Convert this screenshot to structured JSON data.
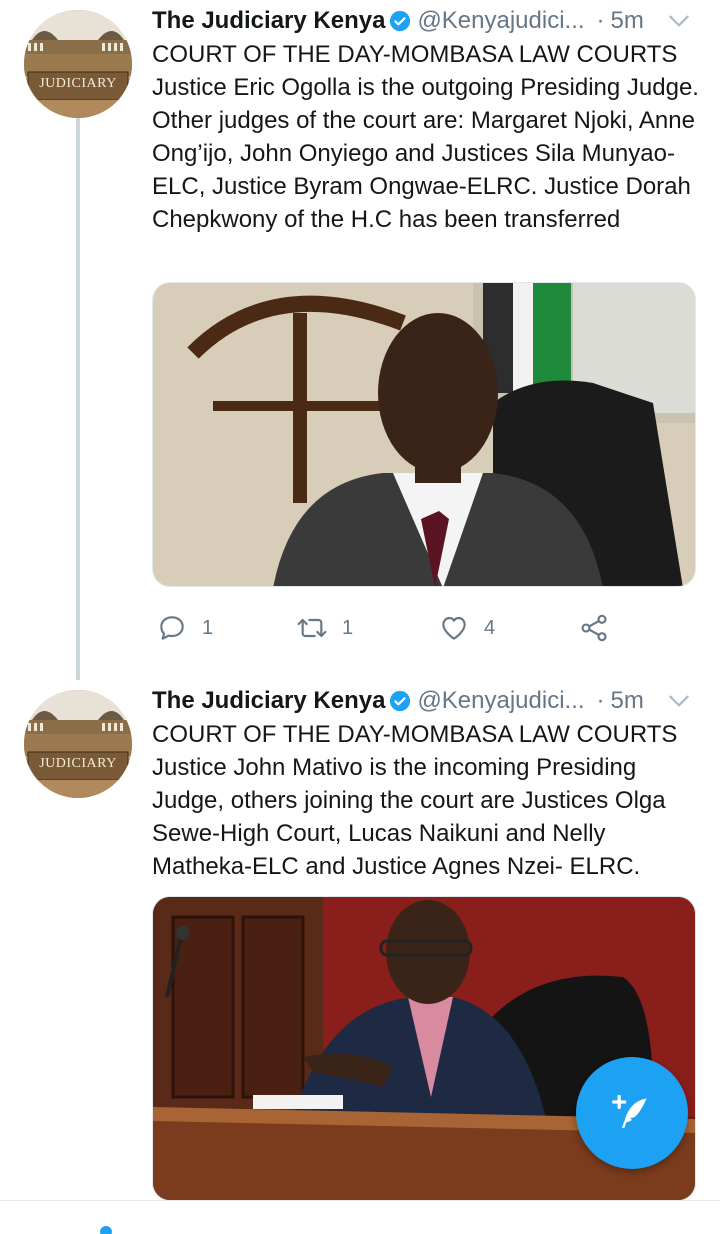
{
  "tweets": [
    {
      "display_name": "The Judiciary Kenya",
      "handle": "@Kenyajudici...",
      "time": "5m",
      "avatar_text": "JUDICIARY",
      "text": "COURT OF THE DAY-MOMBASA LAW COURTS\nJustice Eric Ogolla is the outgoing Presiding Judge.  Other judges of the court are: Margaret Njoki, Anne Ong’ijo, John Onyiego and Justices Sila Munyao-ELC, Justice Byram Ongwae-ELRC. Justice Dorah Chepkwony of the H.C has been transferred",
      "reply_count": "1",
      "retweet_count": "1",
      "like_count": "4"
    },
    {
      "display_name": "The Judiciary Kenya",
      "handle": "@Kenyajudici...",
      "time": "5m",
      "avatar_text": "JUDICIARY",
      "text": "COURT OF THE DAY-MOMBASA LAW COURTS\nJustice John Mativo is the incoming Presiding Judge, others joining the court are Justices Olga Sewe-High Court, Lucas Naikuni and Nelly Matheka-ELC and Justice Agnes Nzei- ELRC."
    }
  ],
  "icons": {
    "verified": "verified-badge-icon",
    "caret": "chevron-down-icon",
    "reply": "reply-icon",
    "retweet": "retweet-icon",
    "like": "heart-icon",
    "share": "share-icon",
    "compose": "compose-tweet-icon"
  },
  "colors": {
    "accent": "#1da1f2",
    "muted": "#657786",
    "text": "#14171a"
  }
}
